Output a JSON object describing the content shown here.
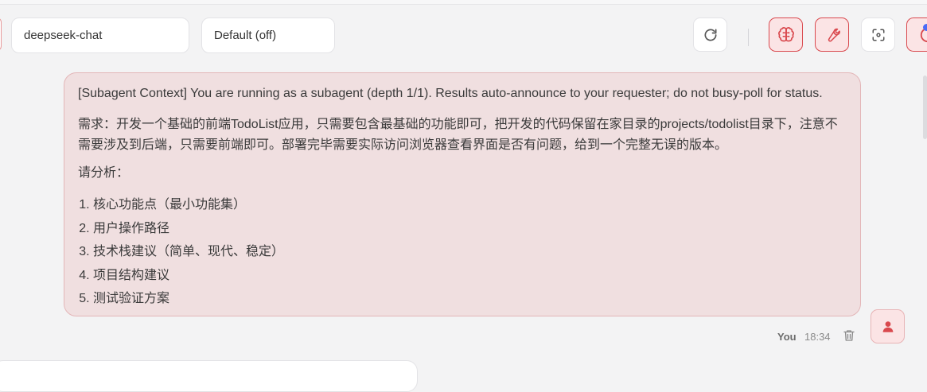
{
  "toolbar": {
    "model_value": "deepseek-chat",
    "mode_value": "Default (off)",
    "icons": {
      "refresh": "refresh-icon",
      "brain": "brain-icon",
      "wrench": "wrench-icon",
      "focus": "scan-focus-icon",
      "history": "clock-icon"
    }
  },
  "message": {
    "context": "[Subagent Context] You are running as a subagent (depth 1/1). Results auto-announce to your requester; do not busy-poll for status.",
    "requirement": "需求：开发一个基础的前端TodoList应用，只需要包含最基础的功能即可，把开发的代码保留在家目录的projects/todolist目录下，注意不需要涉及到后端，只需要前端即可。部署完毕需要实际访问浏览器查看界面是否有问题，给到一个完整无误的版本。",
    "analyze_label": "请分析：",
    "items": [
      "核心功能点（最小功能集）",
      "用户操作路径",
      "技术栈建议（简单、现代、稳定）",
      "项目结构建议",
      "测试验证方案"
    ],
    "sender": "You",
    "time": "18:34"
  },
  "colors": {
    "accent_red": "#d9494e",
    "bubble_bg": "#f0dfe0",
    "bubble_border": "#e3b6b8",
    "page_bg": "#f3f3f4"
  }
}
